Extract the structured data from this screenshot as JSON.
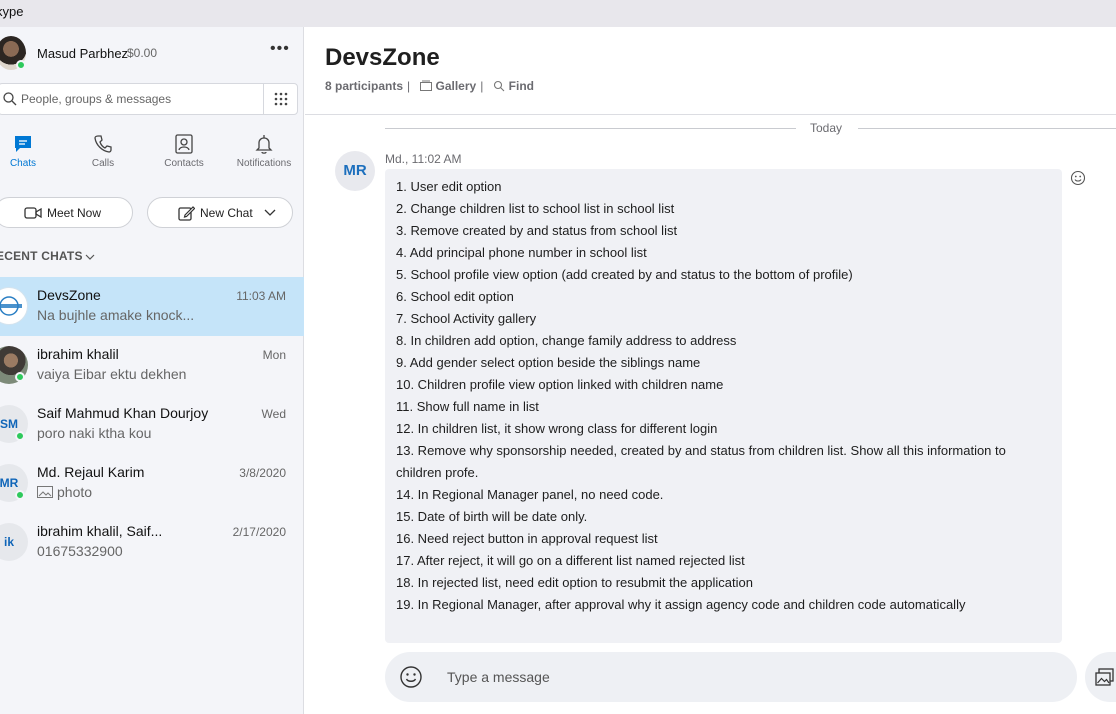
{
  "window": {
    "title": "kype"
  },
  "profile": {
    "name": "Masud Parbhez",
    "credit": "$0.00",
    "more_label": "•••"
  },
  "search": {
    "placeholder": "People, groups & messages"
  },
  "nav": [
    {
      "label": "Chats",
      "icon": "chat-icon",
      "active": true
    },
    {
      "label": "Calls",
      "icon": "phone-icon",
      "active": false
    },
    {
      "label": "Contacts",
      "icon": "contacts-icon",
      "active": false
    },
    {
      "label": "Notifications",
      "icon": "bell-icon",
      "active": false
    }
  ],
  "actions": {
    "meet_now": "Meet Now",
    "new_chat": "New Chat"
  },
  "recent": {
    "header": "ECENT CHATS",
    "chats": [
      {
        "name": "DevsZone",
        "preview": "Na bujhle amake knock...",
        "time": "11:03 AM",
        "avatar": "",
        "active": true
      },
      {
        "name": "ibrahim khalil",
        "preview": "vaiya Eibar ektu dekhen",
        "time": "Mon",
        "avatar": "",
        "active": false
      },
      {
        "name": "Saif Mahmud Khan Dourjoy",
        "preview": "poro naki ktha kou",
        "time": "Wed",
        "avatar": "SM",
        "active": false
      },
      {
        "name": "Md. Rejaul Karim",
        "preview": "photo",
        "time": "3/8/2020",
        "avatar": "MR",
        "active": false
      },
      {
        "name": "ibrahim khalil, Saif...",
        "preview": "01675332900",
        "time": "2/17/2020",
        "avatar": "ik",
        "active": false
      }
    ]
  },
  "conversation": {
    "title": "DevsZone",
    "participants": "8 participants",
    "gallery": "Gallery",
    "find": "Find",
    "separator": "|",
    "day_label": "Today",
    "message": {
      "avatar": "MR",
      "meta": "Md., 11:02 AM",
      "lines": [
        "1. User edit option",
        "2. Change children list to school list in school list",
        "3. Remove created by and status from school list",
        "4. Add principal phone number in school list",
        "5. School profile view option (add created by and status to the bottom of profile)",
        "6. School edit option",
        "7. School Activity gallery",
        "8. In children add option, change family address to address",
        "9. Add gender select option beside the siblings name",
        "10. Children profile view option linked with children name",
        "11. Show full name in list",
        "12. In children list, it show wrong class for different login",
        "13. Remove why sponsorship needed, created by and status from children list. Show all this information to",
        "children profe.",
        "14. In Regional Manager panel, no need code.",
        "15. Date of birth will be date only.",
        "16. Need reject button in approval request list",
        "17. After reject, it will go on a different list named rejected list",
        "18. In rejected list, need edit option to resubmit the application",
        "19. In Regional Manager, after approval why it assign agency code and children code automatically"
      ]
    },
    "composer": {
      "placeholder": "Type a message"
    }
  },
  "colors": {
    "accent": "#0078d4",
    "active_chat": "#c5e4f9",
    "online": "#2ec95c"
  }
}
